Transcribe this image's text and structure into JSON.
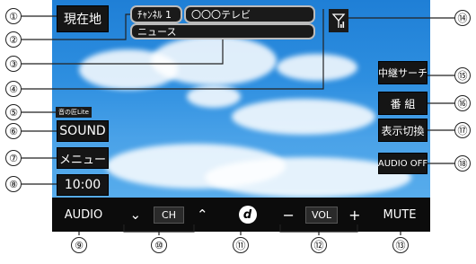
{
  "top_left_button": "現在地",
  "channel": {
    "number": "ﾁｬﾝﾈﾙ 1",
    "station": "〇〇〇テレビ",
    "program": "ニュース"
  },
  "badge": "音の匠Lite",
  "left_buttons": {
    "sound": "SOUND",
    "menu": "メニュー",
    "clock": "10:00"
  },
  "right_buttons": {
    "relay_search": "中継サーチ",
    "program": "番 組",
    "display_switch": "表示切換",
    "audio_off": "AUDIO OFF"
  },
  "bottom_bar": {
    "audio": "AUDIO",
    "ch_label": "CH",
    "ch_down": "⌄",
    "ch_up": "⌃",
    "logo": "d",
    "vol_minus": "−",
    "vol_label": "VOL",
    "vol_plus": "+",
    "mute": "MUTE"
  },
  "callouts": [
    "①",
    "②",
    "③",
    "④",
    "⑤",
    "⑥",
    "⑦",
    "⑧",
    "⑨",
    "⑩",
    "⑪",
    "⑫",
    "⑬",
    "⑭",
    "⑮",
    "⑯",
    "⑰",
    "⑱"
  ],
  "colors": {
    "button_bg": "#151515",
    "sky": "#2e8fe0",
    "pill_border": "#bbb"
  }
}
